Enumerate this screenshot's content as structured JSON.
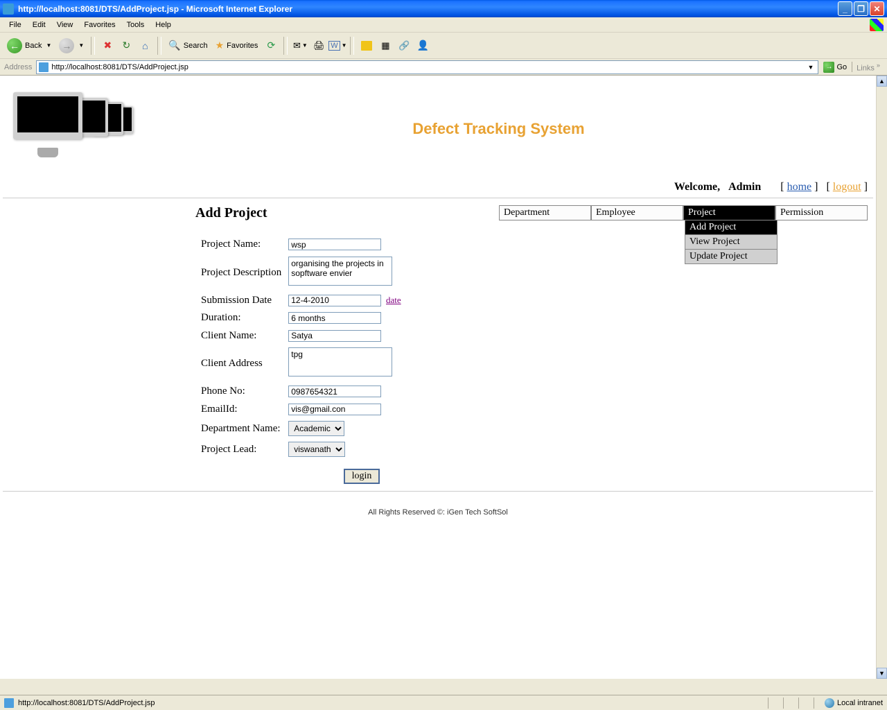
{
  "window": {
    "title": "http://localhost:8081/DTS/AddProject.jsp - Microsoft Internet Explorer"
  },
  "menubar": {
    "file": "File",
    "edit": "Edit",
    "view": "View",
    "favorites": "Favorites",
    "tools": "Tools",
    "help": "Help"
  },
  "toolbar": {
    "back": "Back",
    "search": "Search",
    "favorites": "Favorites"
  },
  "addressbar": {
    "label": "Address",
    "url": "http://localhost:8081/DTS/AddProject.jsp",
    "go": "Go",
    "links": "Links"
  },
  "page": {
    "system_title": "Defect Tracking System",
    "welcome": "Welcome,",
    "user": "Admin",
    "home": "home",
    "logout": "logout",
    "heading": "Add Project",
    "nav": {
      "department": "Department",
      "employee": "Employee",
      "project": "Project",
      "permission": "Permission"
    },
    "subnav": {
      "add": "Add Project",
      "view": "View Project",
      "update": "Update Project"
    },
    "labels": {
      "project_name": "Project Name:",
      "project_description": "Project Description",
      "submission_date": "Submission Date",
      "duration": "Duration:",
      "client_name": "Client Name:",
      "client_address": "Client Address",
      "phone_no": "Phone No:",
      "email_id": "EmailId:",
      "department_name": "Department Name:",
      "project_lead": "Project Lead:"
    },
    "values": {
      "project_name": "wsp",
      "project_description": "organising the projects in sopftware envier",
      "submission_date": "12-4-2010",
      "date_link": "date",
      "duration": "6 months",
      "client_name": "Satya",
      "client_address": "tpg",
      "phone_no": "0987654321",
      "email_id": "vis@gmail.con",
      "department_name": "Academic",
      "project_lead": "viswanath"
    },
    "submit": "login",
    "footer": "All Rights Reserved ©: iGen Tech SoftSol"
  },
  "statusbar": {
    "url": "http://localhost:8081/DTS/AddProject.jsp",
    "zone": "Local intranet"
  }
}
